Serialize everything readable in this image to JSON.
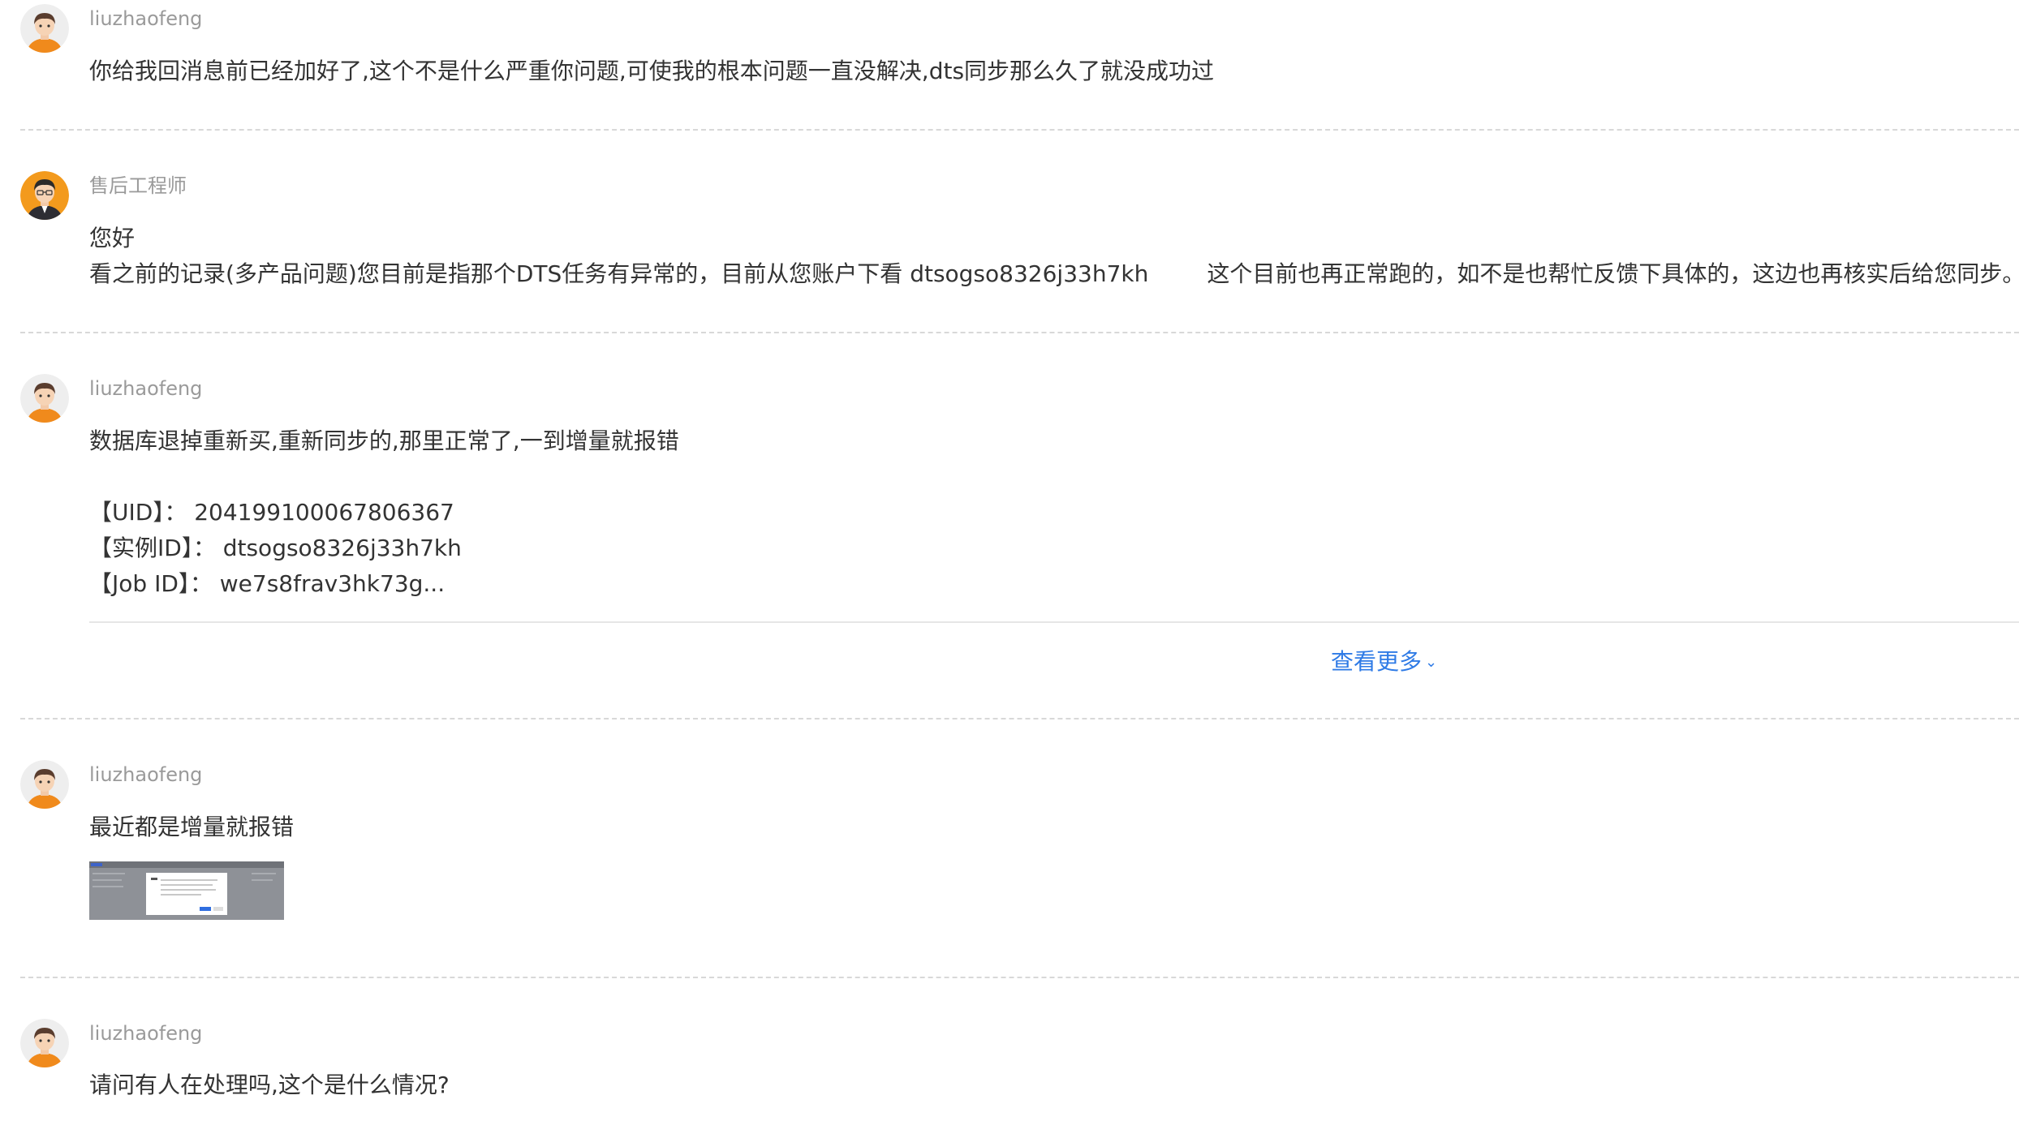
{
  "messages": [
    {
      "author": "liuzhaofeng",
      "avatar": "user-avatar-icon",
      "lines": [
        "你给我回消息前已经加好了,这个不是什么严重你问题,可使我的根本问题一直没解决,dts同步那么久了就没成功过"
      ]
    },
    {
      "author": "售后工程师",
      "avatar": "engineer-avatar-icon",
      "greeting": "您好",
      "line_part1": "看之前的记录(多产品问题)您目前是指那个DTS任务有异常的，目前从您账户下看 dtsogso8326j33h7kh",
      "line_part2": "这个目前也再正常跑的，如不是也帮忙反馈下具体的，这边也再核实后给您同步。"
    },
    {
      "author": "liuzhaofeng",
      "avatar": "user-avatar-icon",
      "line": "数据库退掉重新买,重新同步的,那里正常了,一到增量就报错",
      "fields": [
        "【UID】： 2041991000678063​67",
        "【实例ID】： dtsogso8326j33h7kh",
        "【Job ID】： we7s8frav3hk73g..."
      ],
      "see_more": "查看更多"
    },
    {
      "author": "liuzhaofeng",
      "avatar": "user-avatar-icon",
      "line": "最近都是增量就报错",
      "attachment": "screenshot-thumbnail"
    },
    {
      "author": "liuzhaofeng",
      "avatar": "user-avatar-icon",
      "line": "请问有人在处理吗,这个是什么情况?"
    }
  ],
  "colors": {
    "author": "#9a9a9a",
    "text": "#333333",
    "link": "#2f7be6",
    "divider": "#d8d8d8",
    "avatar_shirt": "#f08a1c"
  }
}
